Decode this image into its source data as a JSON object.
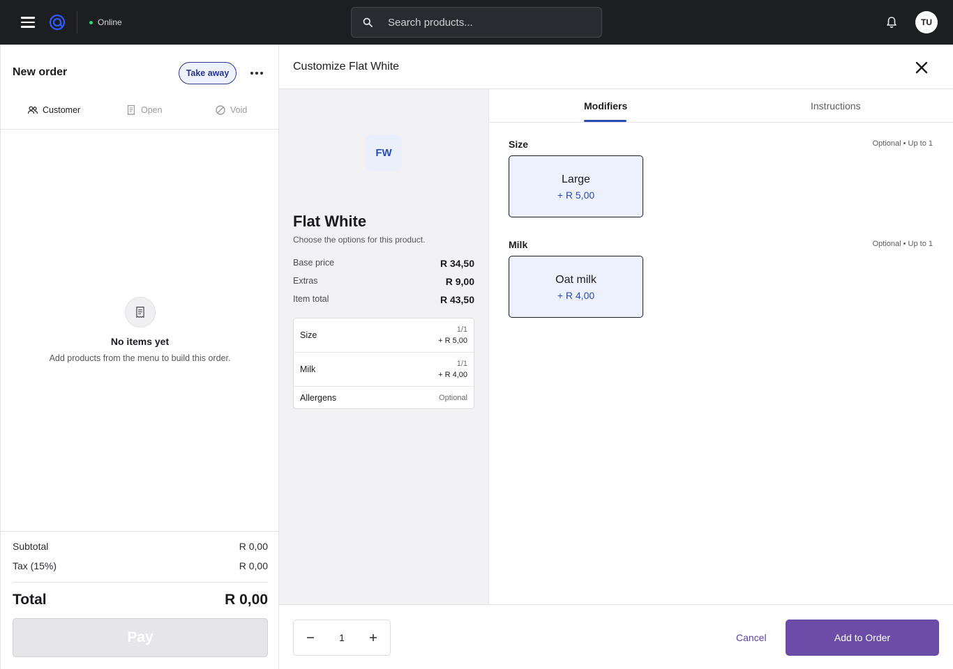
{
  "topbar": {
    "status": "Online",
    "search_placeholder": "Search products...",
    "avatar_initials": "TU",
    "colors": {
      "background": "#1d1e22",
      "status_dot": "#2fd56a",
      "logo": "#2f5bff"
    },
    "icons": [
      "menu-icon",
      "logo-icon",
      "search-icon",
      "bell-icon"
    ]
  },
  "order": {
    "title": "New order",
    "order_type": "Take away",
    "tabs": [
      {
        "label": "Customer",
        "icon": "users-icon"
      },
      {
        "label": "Open",
        "icon": "receipt-icon"
      },
      {
        "label": "Void",
        "icon": "void-icon"
      }
    ],
    "empty_title": "No items yet",
    "empty_subtitle": "Add products from the menu to build this order.",
    "subtotal_label": "Subtotal",
    "subtotal_value": "R 0,00",
    "tax_label": "Tax (15%)",
    "tax_value": "R 0,00",
    "total_label": "Total",
    "total_value": "R 0,00",
    "pay_label": "Pay"
  },
  "customize": {
    "title": "Customize Flat White",
    "product": {
      "initials": "FW",
      "name": "Flat White",
      "description": "Choose the options for this product.",
      "base_price_label": "Base price",
      "base_price": "R 34,50",
      "extras_label": "Extras",
      "extras": "R 9,00",
      "item_total_label": "Item total",
      "item_total": "R 43,50"
    },
    "summary": [
      {
        "name": "Size",
        "count": "1/1",
        "price": "+ R 5,00"
      },
      {
        "name": "Milk",
        "count": "1/1",
        "price": "+ R 4,00"
      },
      {
        "name": "Allergens",
        "note": "Optional"
      }
    ],
    "tabs": {
      "modifiers": "Modifiers",
      "instructions": "Instructions",
      "active": "Modifiers"
    },
    "groups": [
      {
        "title": "Size",
        "hint": "Optional • Up to 1",
        "option": {
          "name": "Large",
          "price": "+ R 5,00"
        }
      },
      {
        "title": "Milk",
        "hint": "Optional • Up to 1",
        "option": {
          "name": "Oat milk",
          "price": "+ R 4,00"
        }
      }
    ],
    "quantity": "1",
    "cancel_label": "Cancel",
    "add_label": "Add to Order",
    "accent_color": "#6b4da8"
  }
}
